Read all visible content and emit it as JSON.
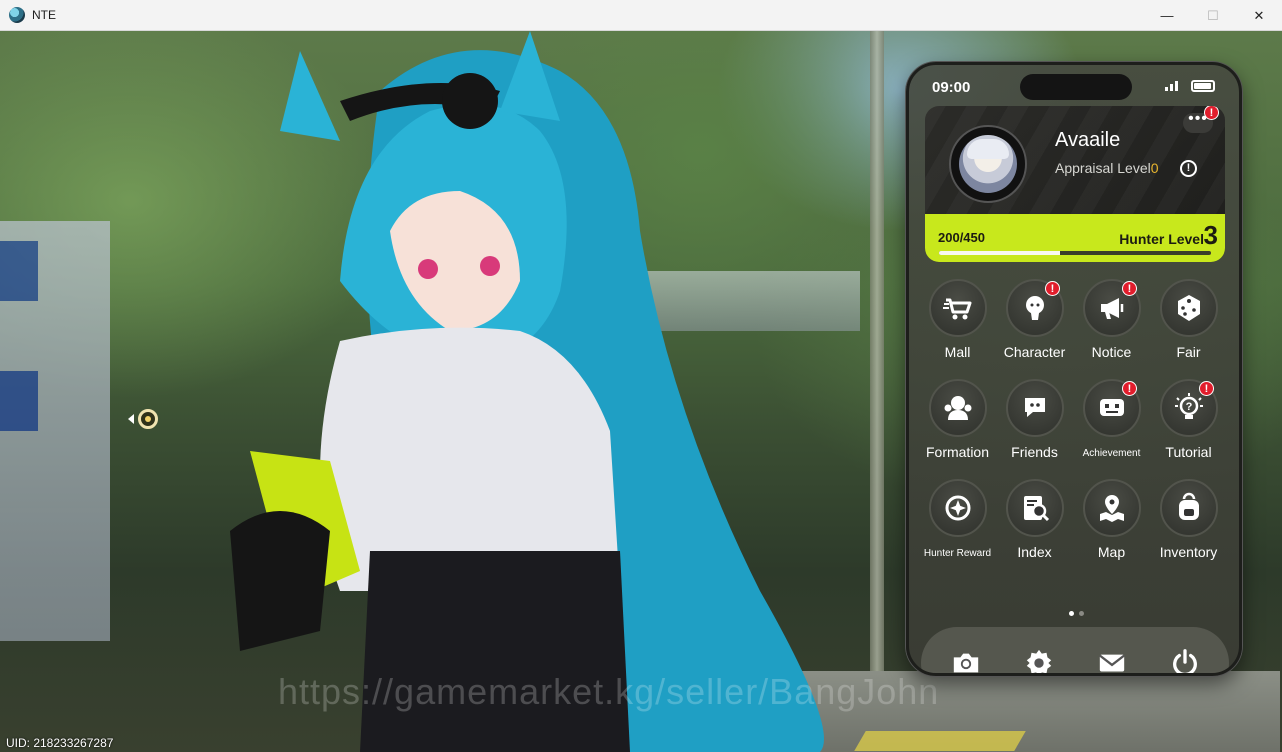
{
  "window": {
    "title": "NTE",
    "minimize": "—",
    "maximize": "☐",
    "close": "✕"
  },
  "watermark": "https://gamemarket.kg/seller/BangJohn",
  "uid": "UID: 218233267287",
  "phone": {
    "time": "09:00",
    "profile": {
      "name": "Avaaile",
      "appraisal_label": "Appraisal Level",
      "appraisal_level": "0",
      "exp_text": "200/450",
      "hunter_label": "Hunter Level",
      "hunter_level": "3",
      "exp_progress": 0.444,
      "more_badge": "!"
    },
    "apps": [
      {
        "label": "Mall",
        "icon": "cart-icon",
        "badge": ""
      },
      {
        "label": "Character",
        "icon": "character-icon",
        "badge": "!"
      },
      {
        "label": "Notice",
        "icon": "megaphone-icon",
        "badge": "!"
      },
      {
        "label": "Fair",
        "icon": "dice-icon",
        "badge": ""
      },
      {
        "label": "Formation",
        "icon": "formation-icon",
        "badge": ""
      },
      {
        "label": "Friends",
        "icon": "friends-icon",
        "badge": ""
      },
      {
        "label": "Achievement",
        "icon": "achievement-icon",
        "badge": "!"
      },
      {
        "label": "Tutorial",
        "icon": "lightbulb-icon",
        "badge": "!"
      },
      {
        "label": "Hunter Reward",
        "icon": "target-icon",
        "badge": ""
      },
      {
        "label": "Index",
        "icon": "index-icon",
        "badge": ""
      },
      {
        "label": "Map",
        "icon": "map-icon",
        "badge": ""
      },
      {
        "label": "Inventory",
        "icon": "backpack-icon",
        "badge": ""
      }
    ],
    "dock": [
      {
        "name": "camera",
        "icon": "camera-icon"
      },
      {
        "name": "settings",
        "icon": "gear-icon"
      },
      {
        "name": "mail",
        "icon": "mail-icon"
      },
      {
        "name": "power",
        "icon": "power-icon"
      }
    ],
    "colors": {
      "accent": "#c8e81c",
      "badge": "#e11d2c",
      "appraisal": "#e8b52e"
    }
  }
}
